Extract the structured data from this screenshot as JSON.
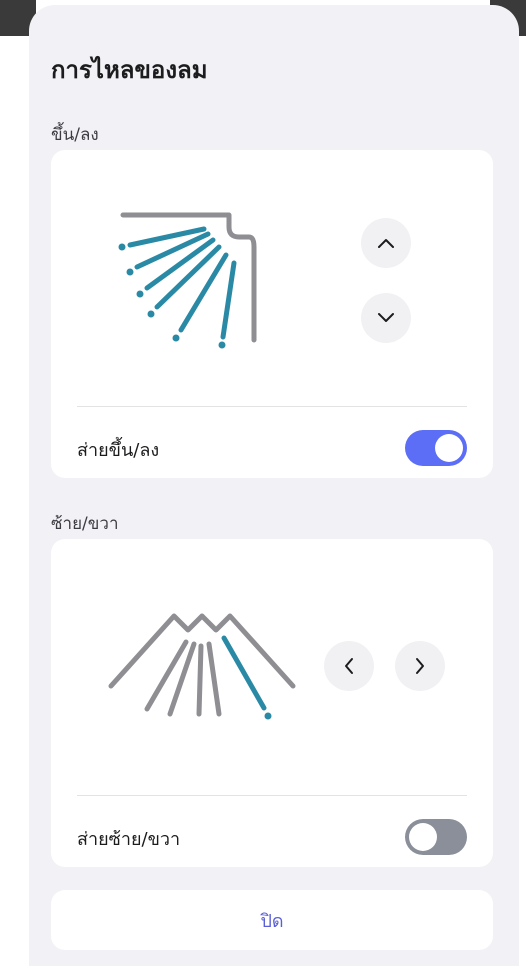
{
  "sheet": {
    "title": "การไหลของลม",
    "close_label": "ปิด"
  },
  "vertical": {
    "section_label": "ขึ้น/ลง",
    "swing_label": "ส่ายขึ้น/ลง",
    "swing_on": true,
    "up_icon": "chevron-up-icon",
    "down_icon": "chevron-down-icon"
  },
  "horizontal": {
    "section_label": "ซ้าย/ขวา",
    "swing_label": "ส่ายซ้าย/ขวา",
    "swing_on": false,
    "left_icon": "chevron-left-icon",
    "right_icon": "chevron-right-icon"
  },
  "colors": {
    "sheet_bg": "#f2f2f6",
    "card_bg": "#ffffff",
    "accent": "#5a5fd8",
    "toggle_on": "#5b6ef5",
    "toggle_off": "#8a8f99",
    "airflow_active": "#2a8aa6",
    "airflow_inactive": "#8e8e93"
  }
}
